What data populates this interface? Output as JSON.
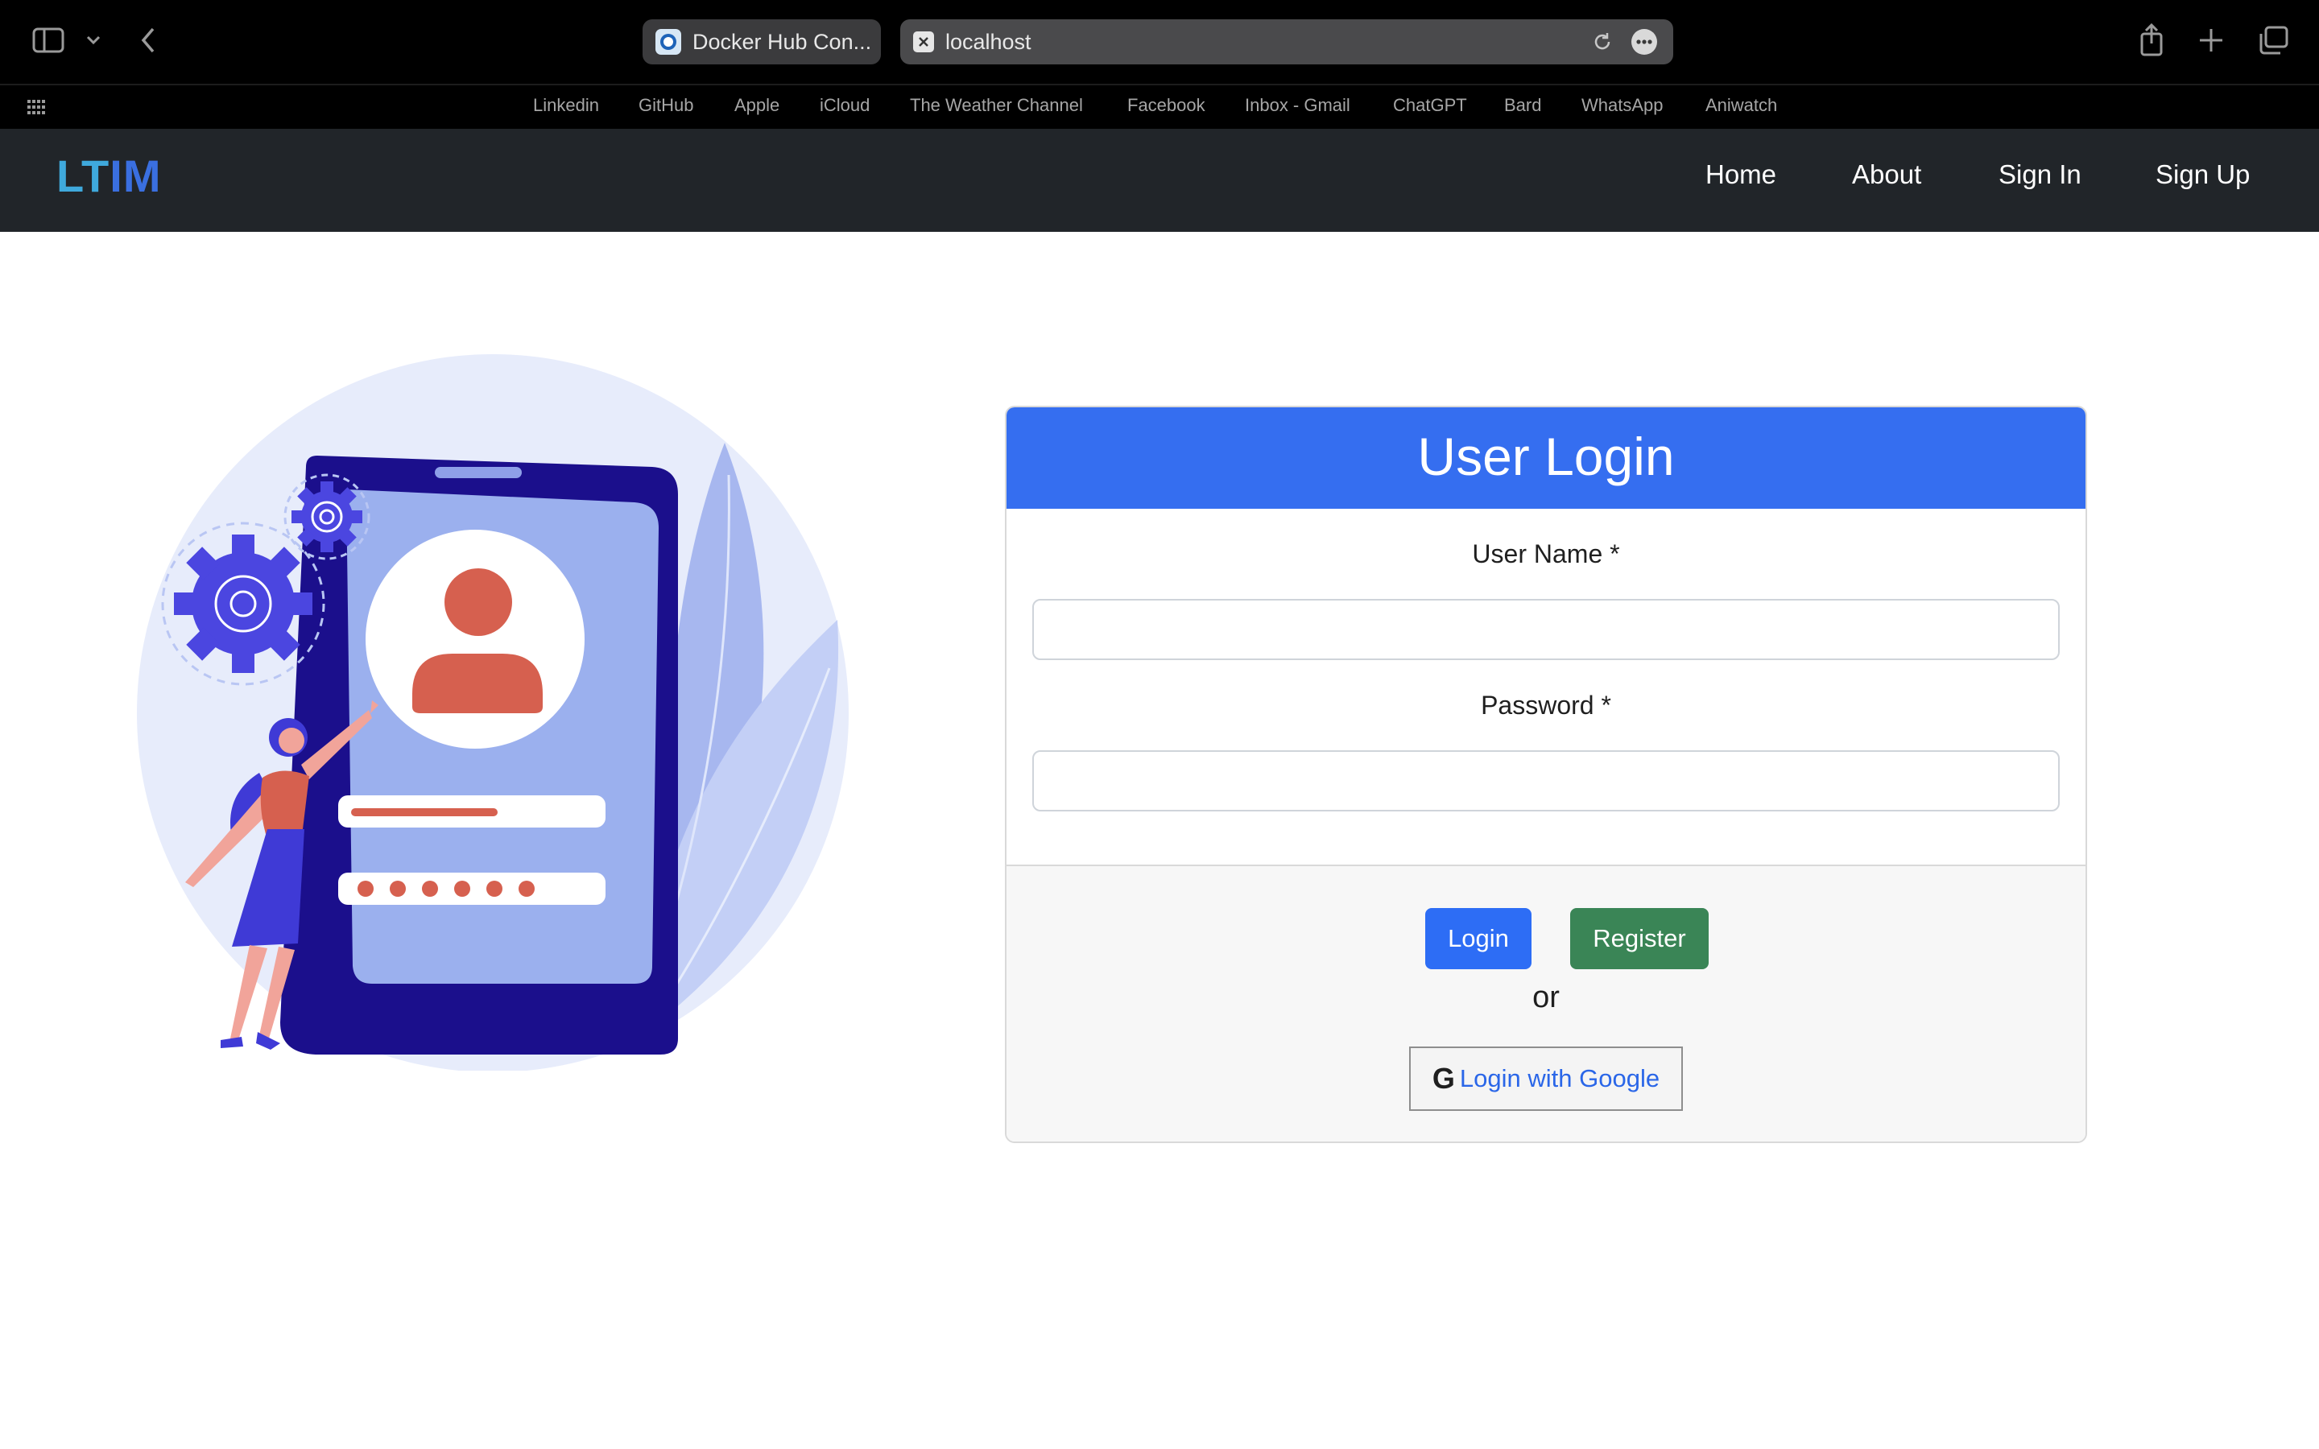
{
  "browser": {
    "tabs": [
      {
        "label": "Docker Hub Con..."
      },
      {
        "label": "localhost"
      }
    ],
    "bookmarks": [
      "Linkedin",
      "GitHub",
      "Apple",
      "iCloud",
      "The Weather Channel",
      "Facebook",
      "Inbox - Gmail",
      "ChatGPT",
      "Bard",
      "WhatsApp",
      "Aniwatch"
    ],
    "icons": [
      "sidebar-icon",
      "chevron-down-icon",
      "back-icon",
      "reload-icon",
      "more-icon",
      "share-icon",
      "new-tab-icon",
      "tab-overview-icon",
      "grid-icon"
    ]
  },
  "navbar": {
    "brand_part1": "LT",
    "brand_part2": "IM",
    "links": [
      "Home",
      "About",
      "Sign In",
      "Sign Up"
    ]
  },
  "login": {
    "title": "User Login",
    "username_label": "User Name *",
    "username_value": "",
    "password_label": "Password *",
    "password_value": "",
    "login_button": "Login",
    "register_button": "Register",
    "or_text": "or",
    "google_icon_glyph": "G",
    "google_button": "Login with Google"
  },
  "colors": {
    "navbar_bg": "#212529",
    "card_header": "#356ef0",
    "login_button": "#2d6df5",
    "register_button": "#3a8556",
    "google_link": "#2a66e8"
  }
}
